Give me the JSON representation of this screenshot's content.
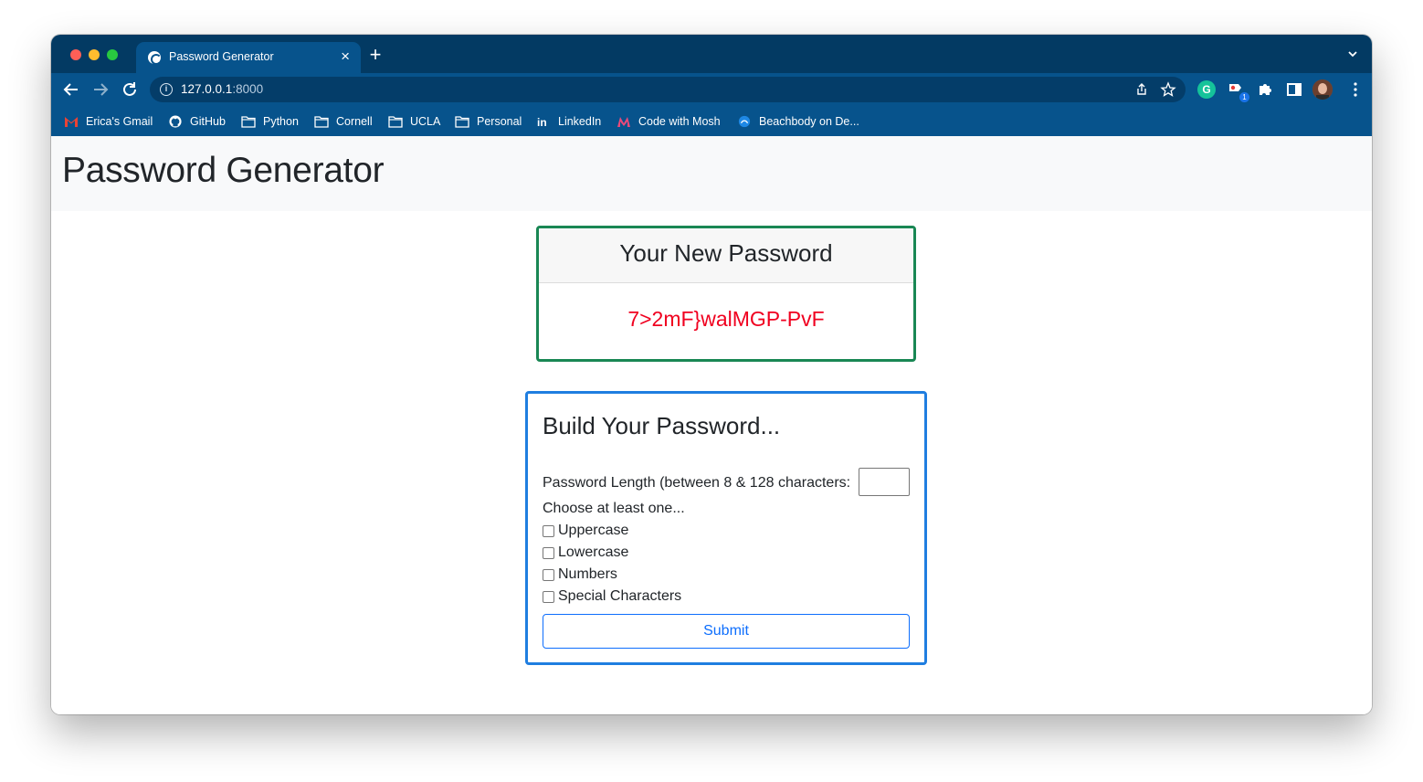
{
  "browser": {
    "tab": {
      "title": "Password Generator",
      "close_glyph": "×"
    },
    "new_tab_glyph": "+",
    "url": {
      "host": "127.0.0.1",
      "port": ":8000"
    },
    "extensions": {
      "grammarly_letter": "G",
      "badge_count": "1"
    },
    "bookmarks": [
      {
        "label": "Erica's Gmail",
        "icon": "gmail-icon"
      },
      {
        "label": "GitHub",
        "icon": "github-icon"
      },
      {
        "label": "Python",
        "icon": "folder-icon"
      },
      {
        "label": "Cornell",
        "icon": "folder-icon"
      },
      {
        "label": "UCLA",
        "icon": "folder-icon"
      },
      {
        "label": "Personal",
        "icon": "folder-icon"
      },
      {
        "label": "LinkedIn",
        "icon": "linkedin-icon"
      },
      {
        "label": "Code with Mosh",
        "icon": "mosh-icon"
      },
      {
        "label": "Beachbody on De...",
        "icon": "beachbody-icon"
      }
    ],
    "colors": {
      "frame": "#033a63",
      "toolbar": "#07538c"
    }
  },
  "page": {
    "heading": "Password Generator",
    "result": {
      "title": "Your New Password",
      "password": "7>2mF}walMGP-PvF"
    },
    "builder": {
      "title": "Build Your Password...",
      "length_label": "Password Length (between 8 & 128 characters:",
      "length_value": "",
      "choose_label": "Choose at least one...",
      "options": [
        {
          "label": "Uppercase",
          "checked": false
        },
        {
          "label": "Lowercase",
          "checked": false
        },
        {
          "label": "Numbers",
          "checked": false
        },
        {
          "label": "Special Characters",
          "checked": false
        }
      ],
      "submit_label": "Submit"
    },
    "colors": {
      "password_text": "#f0001f",
      "result_border": "#198754",
      "builder_border": "#1f7ee0",
      "submit": "#0d6efd"
    }
  }
}
